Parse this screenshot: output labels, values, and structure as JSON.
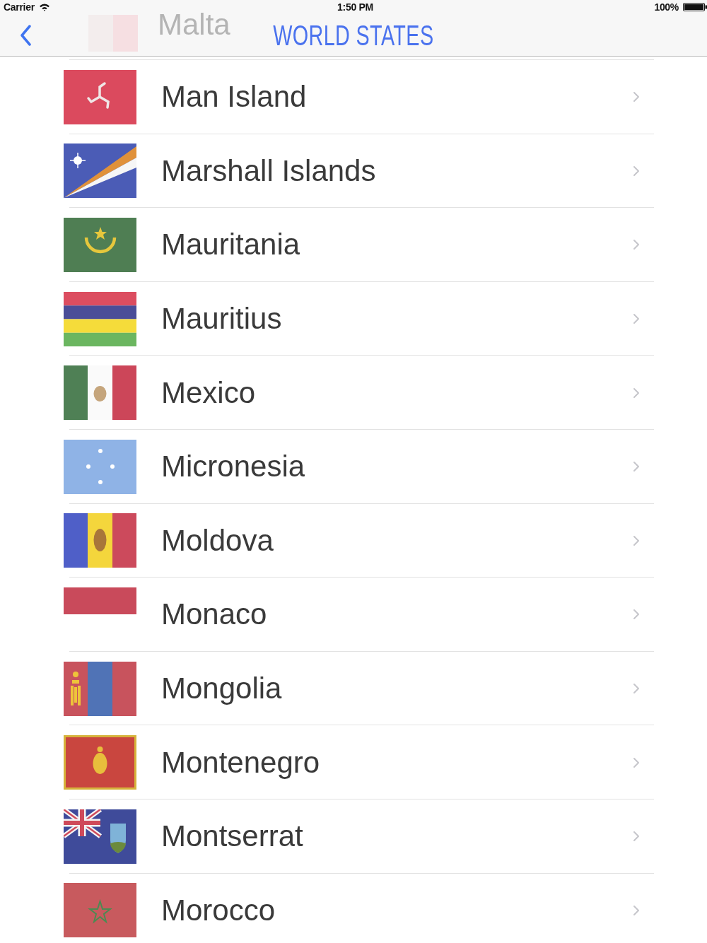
{
  "status_bar": {
    "carrier": "Carrier",
    "time": "1:50 PM",
    "battery": "100%"
  },
  "nav_bar": {
    "title": "WORLD STATES",
    "row_under_bar": {
      "name": "Malta"
    }
  },
  "countries": [
    {
      "name": "Man Island"
    },
    {
      "name": "Marshall Islands"
    },
    {
      "name": "Mauritania"
    },
    {
      "name": "Mauritius"
    },
    {
      "name": "Mexico"
    },
    {
      "name": "Micronesia"
    },
    {
      "name": "Moldova"
    },
    {
      "name": "Monaco"
    },
    {
      "name": "Mongolia"
    },
    {
      "name": "Montenegro"
    },
    {
      "name": "Montserrat"
    },
    {
      "name": "Morocco"
    }
  ]
}
